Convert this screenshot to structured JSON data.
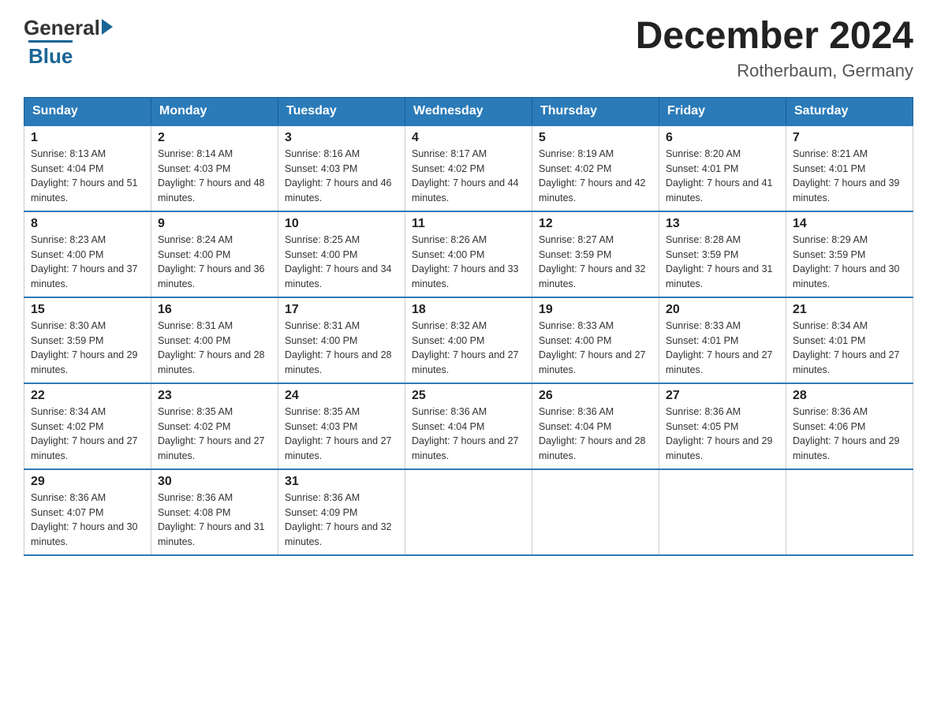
{
  "header": {
    "logo_text1": "General",
    "logo_text2": "Blue",
    "month_title": "December 2024",
    "location": "Rotherbaum, Germany"
  },
  "weekdays": [
    "Sunday",
    "Monday",
    "Tuesday",
    "Wednesday",
    "Thursday",
    "Friday",
    "Saturday"
  ],
  "weeks": [
    [
      {
        "day": "1",
        "sunrise": "8:13 AM",
        "sunset": "4:04 PM",
        "daylight": "7 hours and 51 minutes."
      },
      {
        "day": "2",
        "sunrise": "8:14 AM",
        "sunset": "4:03 PM",
        "daylight": "7 hours and 48 minutes."
      },
      {
        "day": "3",
        "sunrise": "8:16 AM",
        "sunset": "4:03 PM",
        "daylight": "7 hours and 46 minutes."
      },
      {
        "day": "4",
        "sunrise": "8:17 AM",
        "sunset": "4:02 PM",
        "daylight": "7 hours and 44 minutes."
      },
      {
        "day": "5",
        "sunrise": "8:19 AM",
        "sunset": "4:02 PM",
        "daylight": "7 hours and 42 minutes."
      },
      {
        "day": "6",
        "sunrise": "8:20 AM",
        "sunset": "4:01 PM",
        "daylight": "7 hours and 41 minutes."
      },
      {
        "day": "7",
        "sunrise": "8:21 AM",
        "sunset": "4:01 PM",
        "daylight": "7 hours and 39 minutes."
      }
    ],
    [
      {
        "day": "8",
        "sunrise": "8:23 AM",
        "sunset": "4:00 PM",
        "daylight": "7 hours and 37 minutes."
      },
      {
        "day": "9",
        "sunrise": "8:24 AM",
        "sunset": "4:00 PM",
        "daylight": "7 hours and 36 minutes."
      },
      {
        "day": "10",
        "sunrise": "8:25 AM",
        "sunset": "4:00 PM",
        "daylight": "7 hours and 34 minutes."
      },
      {
        "day": "11",
        "sunrise": "8:26 AM",
        "sunset": "4:00 PM",
        "daylight": "7 hours and 33 minutes."
      },
      {
        "day": "12",
        "sunrise": "8:27 AM",
        "sunset": "3:59 PM",
        "daylight": "7 hours and 32 minutes."
      },
      {
        "day": "13",
        "sunrise": "8:28 AM",
        "sunset": "3:59 PM",
        "daylight": "7 hours and 31 minutes."
      },
      {
        "day": "14",
        "sunrise": "8:29 AM",
        "sunset": "3:59 PM",
        "daylight": "7 hours and 30 minutes."
      }
    ],
    [
      {
        "day": "15",
        "sunrise": "8:30 AM",
        "sunset": "3:59 PM",
        "daylight": "7 hours and 29 minutes."
      },
      {
        "day": "16",
        "sunrise": "8:31 AM",
        "sunset": "4:00 PM",
        "daylight": "7 hours and 28 minutes."
      },
      {
        "day": "17",
        "sunrise": "8:31 AM",
        "sunset": "4:00 PM",
        "daylight": "7 hours and 28 minutes."
      },
      {
        "day": "18",
        "sunrise": "8:32 AM",
        "sunset": "4:00 PM",
        "daylight": "7 hours and 27 minutes."
      },
      {
        "day": "19",
        "sunrise": "8:33 AM",
        "sunset": "4:00 PM",
        "daylight": "7 hours and 27 minutes."
      },
      {
        "day": "20",
        "sunrise": "8:33 AM",
        "sunset": "4:01 PM",
        "daylight": "7 hours and 27 minutes."
      },
      {
        "day": "21",
        "sunrise": "8:34 AM",
        "sunset": "4:01 PM",
        "daylight": "7 hours and 27 minutes."
      }
    ],
    [
      {
        "day": "22",
        "sunrise": "8:34 AM",
        "sunset": "4:02 PM",
        "daylight": "7 hours and 27 minutes."
      },
      {
        "day": "23",
        "sunrise": "8:35 AM",
        "sunset": "4:02 PM",
        "daylight": "7 hours and 27 minutes."
      },
      {
        "day": "24",
        "sunrise": "8:35 AM",
        "sunset": "4:03 PM",
        "daylight": "7 hours and 27 minutes."
      },
      {
        "day": "25",
        "sunrise": "8:36 AM",
        "sunset": "4:04 PM",
        "daylight": "7 hours and 27 minutes."
      },
      {
        "day": "26",
        "sunrise": "8:36 AM",
        "sunset": "4:04 PM",
        "daylight": "7 hours and 28 minutes."
      },
      {
        "day": "27",
        "sunrise": "8:36 AM",
        "sunset": "4:05 PM",
        "daylight": "7 hours and 29 minutes."
      },
      {
        "day": "28",
        "sunrise": "8:36 AM",
        "sunset": "4:06 PM",
        "daylight": "7 hours and 29 minutes."
      }
    ],
    [
      {
        "day": "29",
        "sunrise": "8:36 AM",
        "sunset": "4:07 PM",
        "daylight": "7 hours and 30 minutes."
      },
      {
        "day": "30",
        "sunrise": "8:36 AM",
        "sunset": "4:08 PM",
        "daylight": "7 hours and 31 minutes."
      },
      {
        "day": "31",
        "sunrise": "8:36 AM",
        "sunset": "4:09 PM",
        "daylight": "7 hours and 32 minutes."
      },
      null,
      null,
      null,
      null
    ]
  ]
}
